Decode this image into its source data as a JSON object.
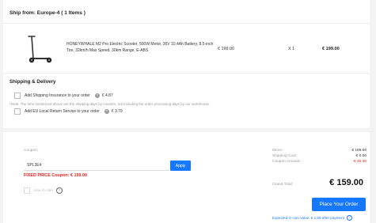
{
  "shipment": {
    "heading": "Ship from: Europe-4 ( 1 Items )",
    "item": {
      "name": "HONEYWHALE M2 Pro Electric Scooter, 500W Motor, 36V 10.4Ah Battery, 8.5-inch Tire, 32km/h Max Speed, 30km Range, E-ABS",
      "unit_price": "€ 199.00",
      "quantity": "X 1",
      "total": "€ 199.00",
      "image_icon": "scooter-icon"
    }
  },
  "shipping_delivery": {
    "heading": "Shipping & Delivery",
    "insurance": {
      "label": "Add Shipping Insurance to your order",
      "price": "€ 4.87"
    },
    "note": "*Note: The time mentioned above are the shipping days by couriers, not including the order processing days by our warehouse.",
    "return_service": {
      "label": "Add EU Local Return Service to your order",
      "price": "€ 3.79"
    }
  },
  "coupon": {
    "label": "Coupon:",
    "code": "SPL3E4",
    "apply_label": "Apply",
    "fixed_price": "FIXED PRICE Coupon: € 159.00",
    "gcoin_label": "Use G-coin"
  },
  "summary": {
    "items_label": "Items:",
    "items_value": "€ 199.00",
    "shipping_label": "Shipping Cost:",
    "shipping_value": "€ 0.00",
    "coupon_label": "Coupon Amount:",
    "coupon_value": "-€ 40.00",
    "grand_label": "Grand Total:",
    "grand_value": "€ 159.00",
    "place_order_label": "Place Your Order",
    "gcoin_expected": "Expected G-coin value: € 1.59 after payment"
  },
  "colors": {
    "accent": "#1677ff",
    "danger": "#e0231e"
  }
}
